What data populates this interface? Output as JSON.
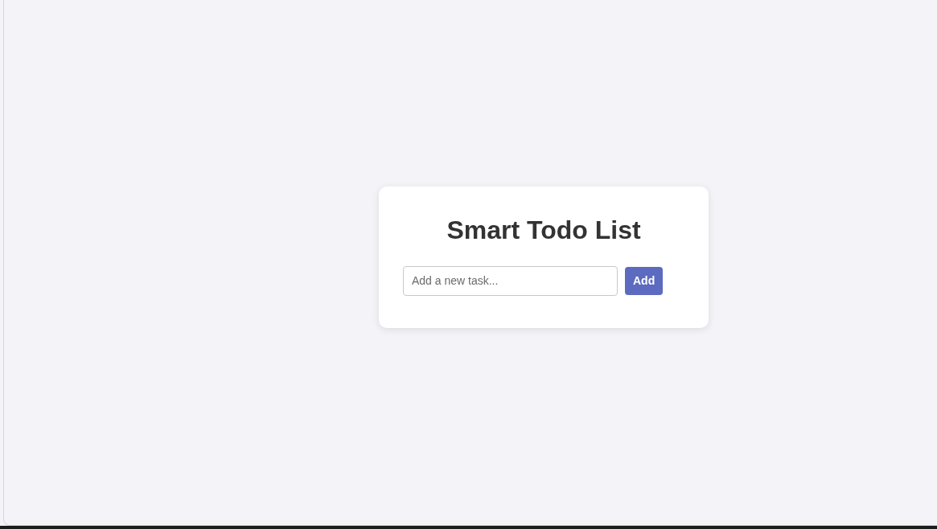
{
  "card": {
    "title": "Smart Todo List",
    "input": {
      "placeholder": "Add a new task..."
    },
    "add_button": {
      "label": "Add"
    }
  }
}
